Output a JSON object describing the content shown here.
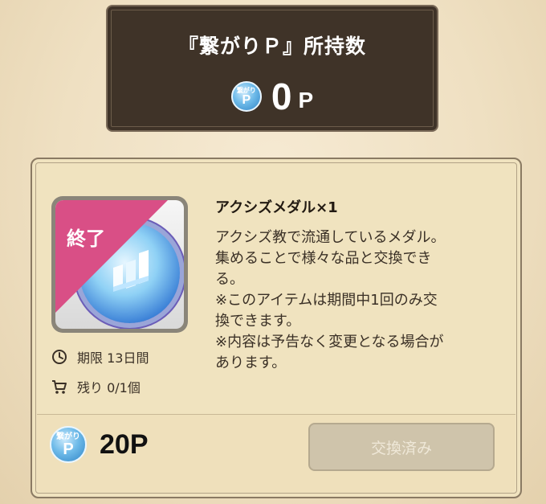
{
  "header": {
    "title": "『繋がりＰ』所持数",
    "points_value": "0",
    "points_unit": "P",
    "coin_kana": "繋がり",
    "coin_letter": "P"
  },
  "item": {
    "status_ribbon": "終了",
    "name": "アクシズメダル×1",
    "description": "アクシズ教で流通しているメダル。\n集めることで様々な品と交換でき\nる。\n※このアイテムは期間中1回のみ交\n換できます。\n※内容は予告なく変更となる場合が\nあります。",
    "period_label": "期限 13日間",
    "remaining_label": "残り 0/1個",
    "icons": [
      "clock-icon",
      "cart-icon",
      "medal-icon"
    ]
  },
  "footer": {
    "cost": "20P",
    "coin_kana": "繋がり",
    "coin_letter": "P",
    "exchange_button": "交換済み"
  },
  "colors": {
    "panel_dark": "#3f3328",
    "card_bg": "#f0e3bf",
    "ribbon": "#d94f86",
    "coin_blue": "#2f84c6",
    "button_disabled": "#cfc4ab"
  }
}
